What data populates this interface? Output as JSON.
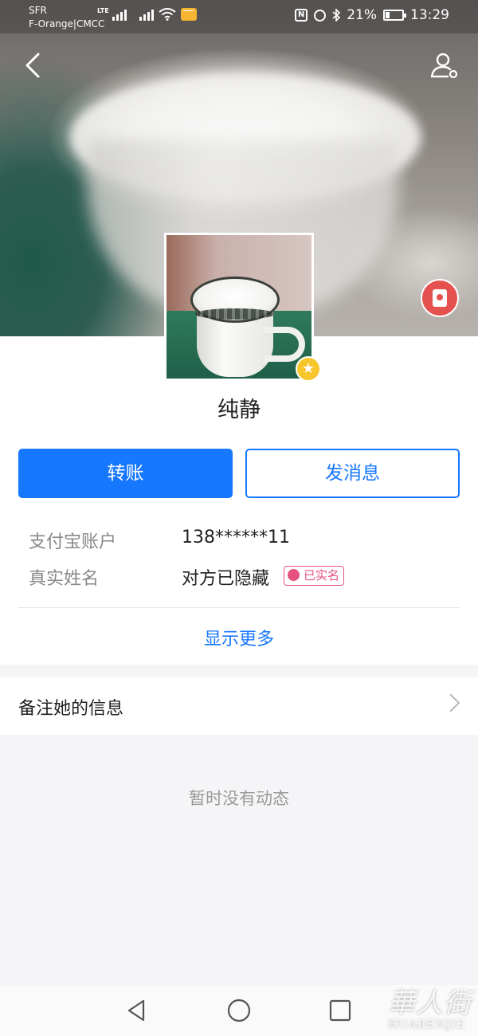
{
  "status_bar": {
    "carrier_line1": "SFR",
    "carrier_line2": "F-Orange|CMCC",
    "network_type": "LTE",
    "battery_percent": "21%",
    "time": "13:29"
  },
  "profile": {
    "name": "纯静"
  },
  "actions": {
    "transfer_label": "转账",
    "message_label": "发消息"
  },
  "info": {
    "account_label": "支付宝账户",
    "account_value": "138******11",
    "real_name_label": "真实姓名",
    "real_name_value": "对方已隐藏",
    "verified_badge": "已实名",
    "show_more": "显示更多"
  },
  "note": {
    "label": "备注她的信息"
  },
  "feed": {
    "empty_text": "暂时没有动态"
  },
  "watermark": {
    "main": "華人街",
    "sub": "HUARENJIE"
  },
  "colors": {
    "primary": "#1677ff",
    "verified": "#e5517f",
    "red_packet": "#e5514f",
    "star_badge": "#f7c52c"
  },
  "icons": [
    "back-arrow-icon",
    "user-settings-icon",
    "red-packet-icon",
    "star-icon",
    "chevron-right-icon",
    "nav-back-icon",
    "nav-home-icon",
    "nav-recents-icon"
  ]
}
